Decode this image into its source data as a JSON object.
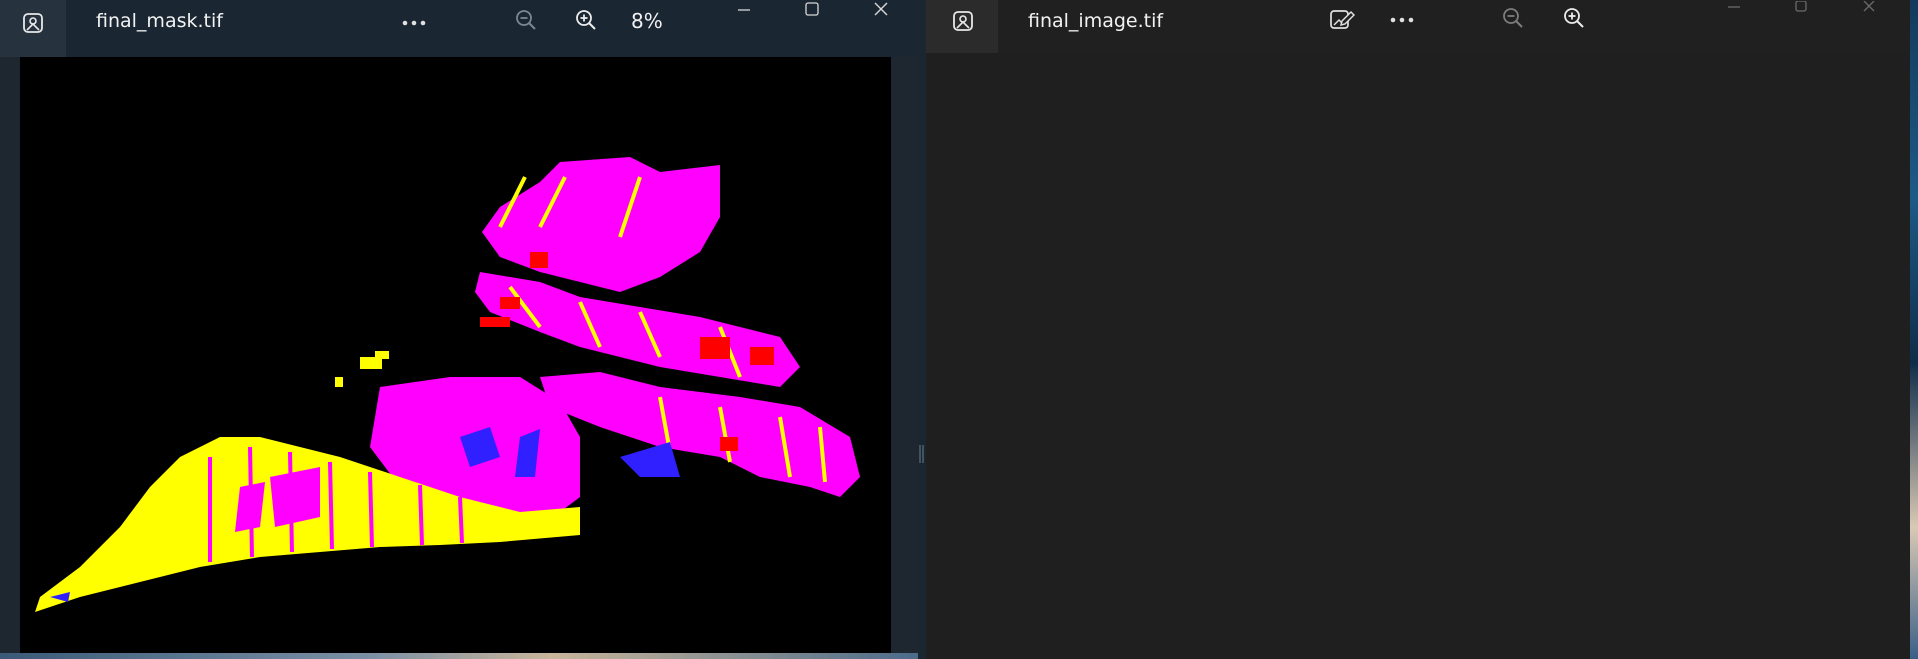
{
  "left_window": {
    "title": "final_mask.tif",
    "zoom": "8%",
    "icons": {
      "app": "photos-app-icon",
      "more": "more-options-icon",
      "zoom_out": "zoom-out-icon",
      "zoom_in": "zoom-in-icon",
      "minimize": "minimize-icon",
      "maximize": "maximize-icon",
      "close": "close-icon"
    }
  },
  "right_window": {
    "title": "final_image.tif",
    "icons": {
      "app": "photos-app-icon",
      "edit": "edit-image-icon",
      "more": "more-options-icon",
      "zoom_out": "zoom-out-icon",
      "zoom_in": "zoom-in-icon",
      "minimize": "minimize-icon",
      "maximize": "maximize-icon",
      "close": "close-icon"
    }
  },
  "colors": {
    "mask_magenta": "#ff00ff",
    "mask_yellow": "#ffff00",
    "mask_red": "#ff0000",
    "mask_blue": "#3020ff",
    "mask_background": "#000000"
  }
}
